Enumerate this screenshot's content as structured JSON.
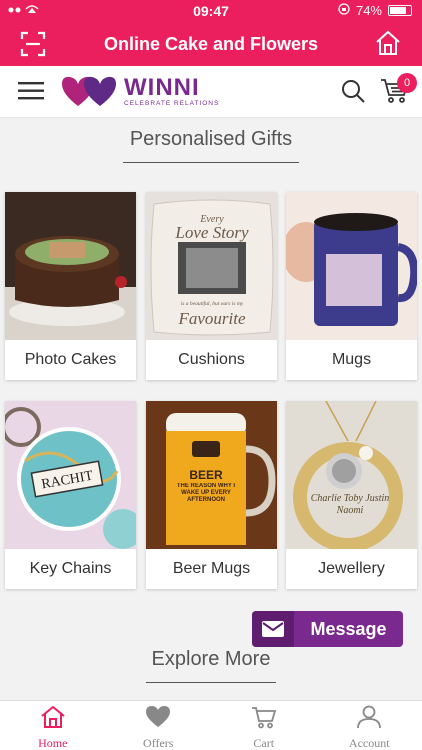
{
  "status_bar": {
    "time": "09:47",
    "battery": "74%",
    "battery_level": 0.74
  },
  "app_bar": {
    "title": "Online Cake and Flowers"
  },
  "header": {
    "logo_name": "WINNI",
    "logo_tagline": "CELEBRATE RELATIONS",
    "cart_count": "0"
  },
  "sections": {
    "personalised": "Personalised Gifts",
    "explore": "Explore More"
  },
  "products": [
    {
      "label": "Photo Cakes",
      "icon": "photo-cake-image"
    },
    {
      "label": "Cushions",
      "icon": "cushion-image",
      "image_text_top": "Every",
      "image_text_mid": "Love Story",
      "image_text_bottom": "Favourite",
      "image_text_small": "is a beautiful, but ours is my"
    },
    {
      "label": "Mugs",
      "icon": "mug-image"
    },
    {
      "label": "Key Chains",
      "icon": "keychain-image",
      "image_text": "RACHIT"
    },
    {
      "label": "Beer Mugs",
      "icon": "beer-mug-image",
      "image_text_main": "BEER",
      "image_text_sub": "THE REASON WHY I WAKE UP EVERY AFTERNOON"
    },
    {
      "label": "Jewellery",
      "icon": "jewellery-image",
      "image_text": "Charlie Toby Justin Naomi"
    }
  ],
  "message_button": {
    "label": "Message"
  },
  "tabs": [
    {
      "label": "Home",
      "icon": "home-icon",
      "active": true
    },
    {
      "label": "Offers",
      "icon": "heart-icon",
      "active": false
    },
    {
      "label": "Cart",
      "icon": "cart-icon",
      "active": false
    },
    {
      "label": "Account",
      "icon": "account-icon",
      "active": false
    }
  ],
  "colors": {
    "primary": "#ec1f5e",
    "brand_purple": "#7a2a8e"
  }
}
